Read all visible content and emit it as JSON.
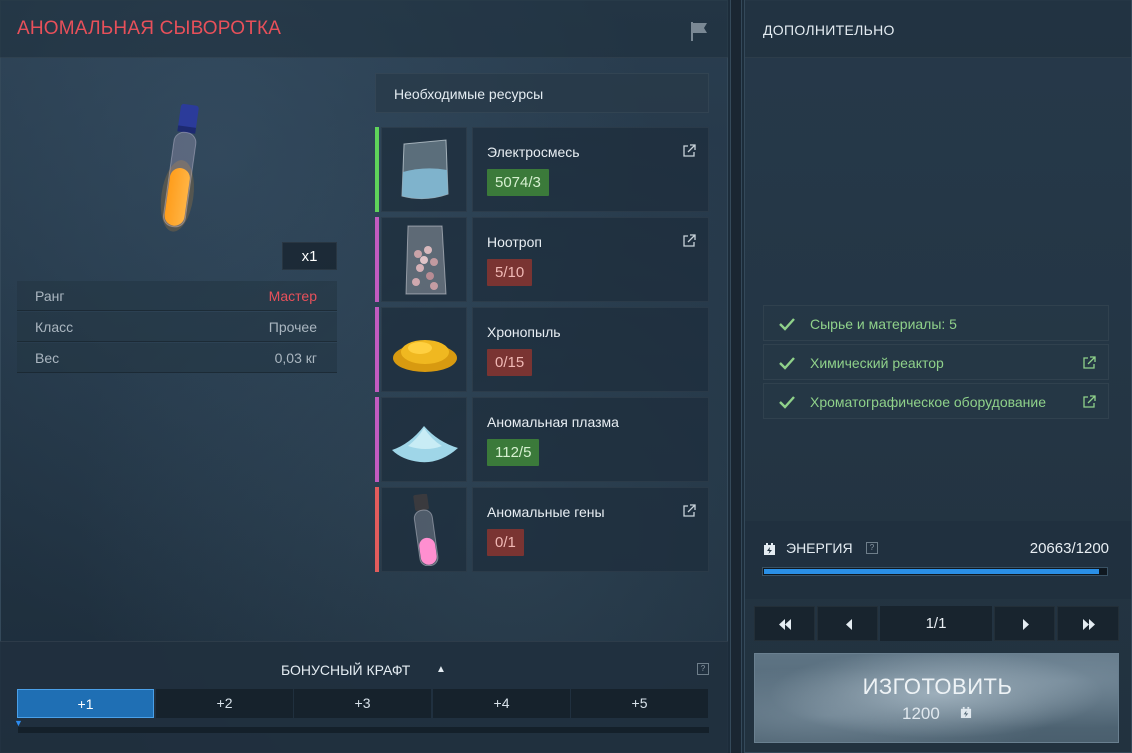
{
  "item": {
    "title": "АНОМАЛЬНАЯ СЫВОРОТКА",
    "quantity": "x1",
    "image_icon": "serum-vial-icon",
    "stats": [
      {
        "key": "Ранг",
        "value": "Мастер"
      },
      {
        "key": "Класс",
        "value": "Прочее"
      },
      {
        "key": "Вес",
        "value": "0,03 кг"
      }
    ]
  },
  "resources": {
    "header": "Необходимые ресурсы",
    "items": [
      {
        "name": "Электросмесь",
        "count": "5074/3",
        "status": "ok",
        "rarity_color": "#5fd35a",
        "icon": "beaker-powder-icon",
        "has_link": true
      },
      {
        "name": "Ноотроп",
        "count": "5/10",
        "status": "bad",
        "rarity_color": "#c25bc0",
        "icon": "pill-bag-icon",
        "has_link": true
      },
      {
        "name": "Хронопыль",
        "count": "0/15",
        "status": "bad",
        "rarity_color": "#c25bc0",
        "icon": "gold-dust-icon",
        "has_link": false
      },
      {
        "name": "Аномальная плазма",
        "count": "112/5",
        "status": "ok",
        "rarity_color": "#c25bc0",
        "icon": "plasma-pile-icon",
        "has_link": false
      },
      {
        "name": "Аномальные гены",
        "count": "0/1",
        "status": "bad",
        "rarity_color": "#e25c5c",
        "icon": "gene-vial-icon",
        "has_link": true
      }
    ]
  },
  "bonus_craft": {
    "title": "БОНУСНЫЙ КРАФТ",
    "arrow": "▲",
    "help": "?",
    "tabs": [
      "+1",
      "+2",
      "+3",
      "+4",
      "+5"
    ],
    "active_tab": 0
  },
  "extra": {
    "title": "ДОПОЛНИТЕЛЬНО",
    "requirements": [
      {
        "text": "Сырье и материалы: 5",
        "has_link": false
      },
      {
        "text": "Химический реактор",
        "has_link": true
      },
      {
        "text": "Хроматографическое оборудование",
        "has_link": true
      }
    ]
  },
  "energy": {
    "label": "ЭНЕРГИЯ",
    "help": "?",
    "value": "20663/1200",
    "fill_fraction": 0.98
  },
  "pager": {
    "page": "1/1"
  },
  "craft": {
    "label": "ИЗГОТОВИТЬ",
    "cost": "1200"
  },
  "colors": {
    "title_red": "#e8505a",
    "ok_green": "#3b7a3a",
    "bad_red": "#7a3432",
    "accent_blue": "#2a8fe6",
    "check_green": "#8fd18a"
  }
}
